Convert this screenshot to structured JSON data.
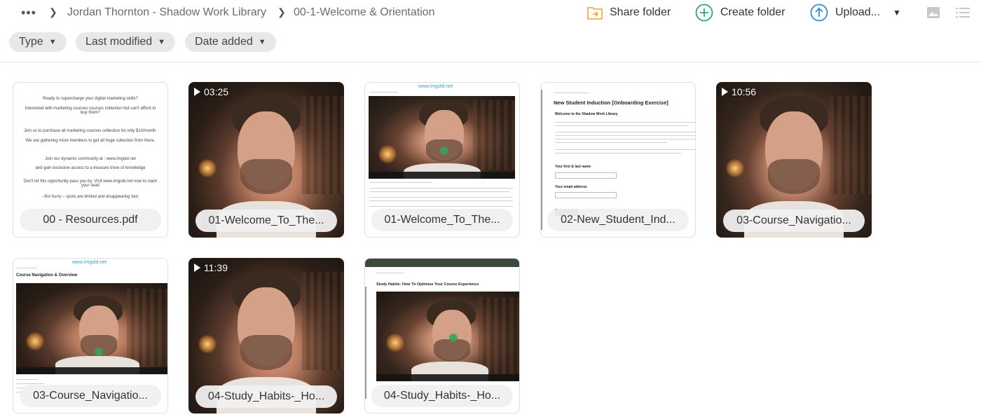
{
  "breadcrumb": {
    "more_icon": "more-horizontal-icon",
    "items": [
      "Jordan Thornton - Shadow Work Library",
      "00-1-Welcome & Orientation"
    ]
  },
  "actions": {
    "share_folder": "Share folder",
    "create_folder": "Create folder",
    "upload": "Upload...",
    "colors": {
      "share": "#f0a030",
      "create": "#2eaa6e",
      "upload": "#2e8fd8"
    }
  },
  "filters": [
    "Type",
    "Last modified",
    "Date added"
  ],
  "files": [
    {
      "name": "00 - Resources.pdf",
      "kind": "pdf",
      "doc_lines": [
        "Ready to supercharge your digital marketing skills?",
        "Interested with marketing courses courses collection but can't afford to buy them?",
        "Join us to purchase all  marketing courses  collection for only $10/month.",
        "We are gathering more members to get all huge collection from there.",
        "Join our dynamic community at : www.imgold.net",
        "and gain exclusive  access to a treasure trove of knowledge",
        "Don't let this opportunity pass you by. Visit www.imgold.net now to claim your seat!",
        "- But hurry – spots are limited and disappearing fast."
      ]
    },
    {
      "name": "01-Welcome_To_The...",
      "kind": "video",
      "duration": "03:25"
    },
    {
      "name": "01-Welcome_To_The...",
      "kind": "doc-video",
      "watermark": "www.imgold.net"
    },
    {
      "name": "02-New_Student_Ind...",
      "kind": "form",
      "doc_title": "New Student Induction [Onboarding Exercise]",
      "doc_sub": "Welcome to the Shadow Work Library",
      "field1": "Your first & last name",
      "field2": "Your email address"
    },
    {
      "name": "03-Course_Navigatio...",
      "kind": "video",
      "duration": "10:56"
    },
    {
      "name": "03-Course_Navigatio...",
      "kind": "doc-video",
      "watermark": "www.imgold.net",
      "doc_title": "Course Navigation & Overview"
    },
    {
      "name": "04-Study_Habits-_Ho...",
      "kind": "video",
      "duration": "11:39"
    },
    {
      "name": "04-Study_Habits-_Ho...",
      "kind": "doc-video",
      "doc_title": "Study Habits: How To Optimise Your Course Experience"
    }
  ]
}
